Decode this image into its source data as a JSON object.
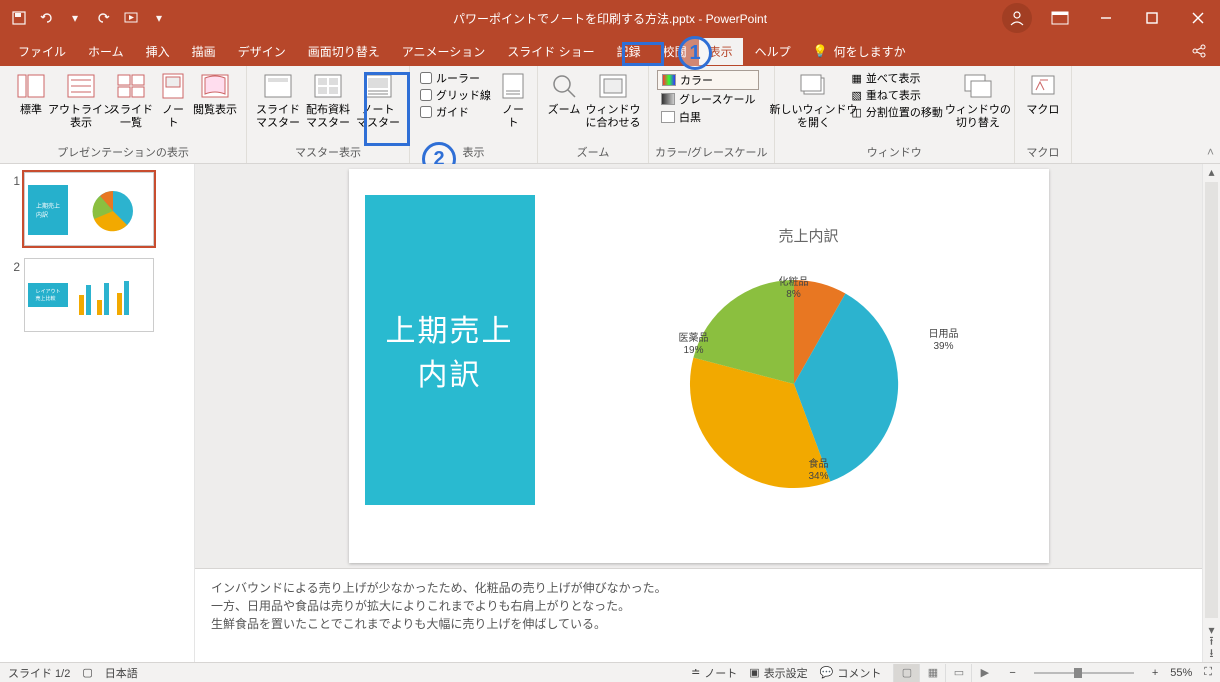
{
  "title": "パワーポイントでノートを印刷する方法.pptx  -  PowerPoint",
  "tabs": [
    "ファイル",
    "ホーム",
    "挿入",
    "描画",
    "デザイン",
    "画面切り替え",
    "アニメーション",
    "スライド ショー",
    "記録",
    "校閲",
    "表示",
    "ヘルプ"
  ],
  "active_tab": 10,
  "tell_me": "何をしますか",
  "ribbon": {
    "presentation_views": {
      "label": "プレゼンテーションの表示",
      "items": [
        "標準",
        "アウトライン\n表示",
        "スライド\n一覧",
        "ノー\nト",
        "閲覧表示"
      ]
    },
    "master_views": {
      "label": "マスター表示",
      "items": [
        "スライド\nマスター",
        "配布資料\nマスター",
        "ノート\nマスター"
      ]
    },
    "show": {
      "label": "表示",
      "items": [
        "ルーラー",
        "グリッド線",
        "ガイド"
      ],
      "note_btn": "ノー\nト"
    },
    "zoom": {
      "label": "ズーム",
      "zoom": "ズーム",
      "fit": "ウィンドウ\nに合わせる"
    },
    "color": {
      "label": "カラー/グレースケール",
      "items": [
        "カラー",
        "グレースケール",
        "白黒"
      ]
    },
    "window": {
      "label": "ウィンドウ",
      "new": "新しいウィンドウ\nを開く",
      "arrange": "並べて表示",
      "cascade": "重ねて表示",
      "split": "分割位置の移動",
      "switch": "ウィンドウの\n切り替え"
    },
    "macro": {
      "label": "マクロ",
      "btn": "マクロ"
    }
  },
  "slide_panel": {
    "title_block": "上期売上\n内訳",
    "chart_title": "売上内訳"
  },
  "chart_data": {
    "type": "pie",
    "title": "売上内訳",
    "series": [
      {
        "name": "化粧品",
        "value": 8,
        "color": "#e87722"
      },
      {
        "name": "日用品",
        "value": 39,
        "color": "#2cb3cf"
      },
      {
        "name": "食品",
        "value": 34,
        "color": "#f2a900"
      },
      {
        "name": "医薬品",
        "value": 19,
        "color": "#8bbf3f"
      }
    ],
    "value_suffix": "%"
  },
  "notes": {
    "line1": "インバウンドによる売り上げが少なかったため、化粧品の売り上げが伸びなかった。",
    "line2": "一方、日用品や食品は売りが拡大によりこれまでよりも右肩上がりとなった。",
    "line3": "生鮮食品を置いたことでこれまでよりも大幅に売り上げを伸ばしている。"
  },
  "status": {
    "slide": "スライド 1/2",
    "lang": "日本語",
    "notes_btn": "ノート",
    "display": "表示設定",
    "comments": "コメント",
    "zoom": "55%"
  },
  "annotations": {
    "badge1": "1",
    "badge2": "2"
  }
}
